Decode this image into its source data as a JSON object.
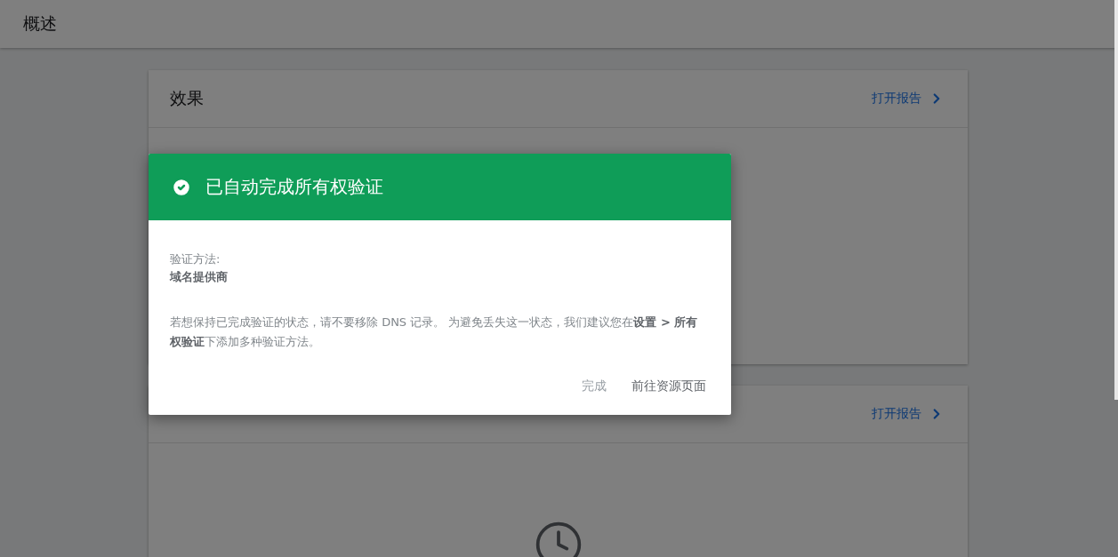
{
  "header": {
    "title": "概述"
  },
  "cards": [
    {
      "title": "效果",
      "link": "打开报告"
    },
    {
      "link": "打开报告"
    }
  ],
  "dialog": {
    "title": "已自动完成所有权验证",
    "method_label": "验证方法:",
    "method_value": "域名提供商",
    "message": "若想保持已完成验证的状态，请不要移除 DNS 记录。 为避免丢失这一状态，我们建议您在**设置 > 所有权验证**下添加多种验证方法。",
    "buttons": [
      {
        "label": "完成",
        "kind": "secondary"
      },
      {
        "label": "前往资源页面",
        "kind": "primary"
      }
    ]
  }
}
